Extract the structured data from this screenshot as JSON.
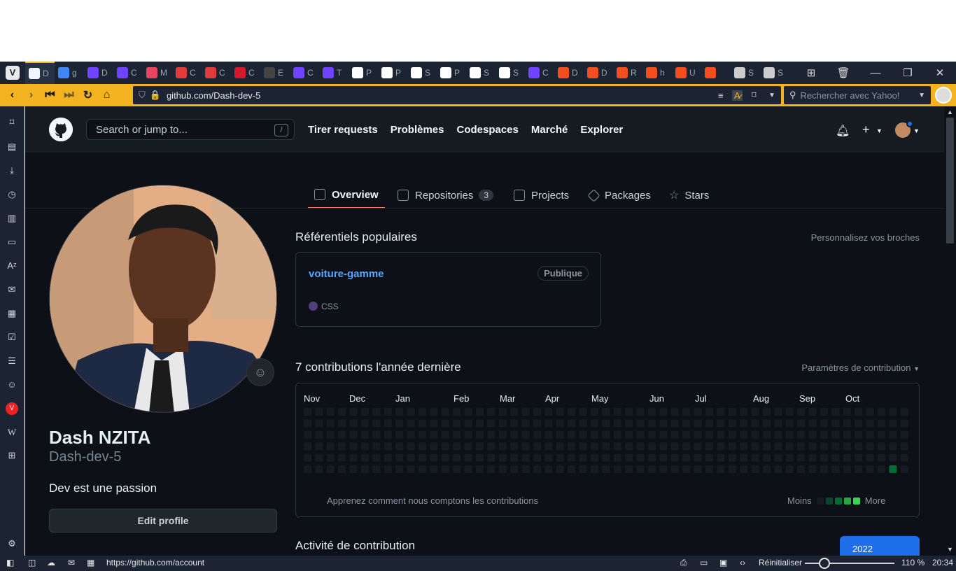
{
  "tabs": [
    {
      "label": "D",
      "icon": "github-icon",
      "color": "#f0f6fc",
      "active": true
    },
    {
      "label": "g",
      "icon": "google-icon",
      "color": "#4285f4"
    },
    {
      "label": "D",
      "icon": "tab-icon",
      "color": "#6e44ff"
    },
    {
      "label": "C",
      "icon": "tab-icon",
      "color": "#6e44ff"
    },
    {
      "label": "M",
      "icon": "tab-icon",
      "color": "#e94560"
    },
    {
      "label": "C",
      "icon": "tab-icon",
      "color": "#e23b3b"
    },
    {
      "label": "C",
      "icon": "tab-icon",
      "color": "#e23b3b"
    },
    {
      "label": "C",
      "icon": "opera-icon",
      "color": "#d11a2a"
    },
    {
      "label": "E",
      "icon": "tab-icon",
      "color": "#444444"
    },
    {
      "label": "C",
      "icon": "tab-icon",
      "color": "#6e44ff"
    },
    {
      "label": "T",
      "icon": "tab-icon",
      "color": "#6e44ff"
    },
    {
      "label": "P",
      "icon": "codepen-icon",
      "color": "#ffffff"
    },
    {
      "label": "P",
      "icon": "codepen-icon",
      "color": "#ffffff"
    },
    {
      "label": "S",
      "icon": "codepen-icon",
      "color": "#ffffff"
    },
    {
      "label": "P",
      "icon": "codepen-icon",
      "color": "#ffffff"
    },
    {
      "label": "S",
      "icon": "codepen-icon",
      "color": "#ffffff"
    },
    {
      "label": "S",
      "icon": "codepen-icon",
      "color": "#ffffff"
    },
    {
      "label": "C",
      "icon": "tab-icon",
      "color": "#6e44ff"
    },
    {
      "label": "D",
      "icon": "figma-icon",
      "color": "#f24e1e"
    },
    {
      "label": "D",
      "icon": "figma-icon",
      "color": "#f24e1e"
    },
    {
      "label": "R",
      "icon": "figma-icon",
      "color": "#f24e1e"
    },
    {
      "label": "h",
      "icon": "figma-icon",
      "color": "#f24e1e"
    },
    {
      "label": "U",
      "icon": "figma-icon",
      "color": "#f24e1e"
    },
    {
      "label": "",
      "icon": "figma-icon",
      "color": "#f24e1e"
    },
    {
      "label": "S",
      "icon": "apps-icon",
      "color": "#cccccc"
    },
    {
      "label": "S",
      "icon": "apps-icon",
      "color": "#cccccc"
    }
  ],
  "browser": {
    "url": "github.com/Dash-dev-5",
    "search_placeholder": "Rechercher avec Yahoo!"
  },
  "github": {
    "search_placeholder": "Search or jump to...",
    "slash": "/",
    "nav": [
      "Tirer requests",
      "Problèmes",
      "Codespaces",
      "Marché",
      "Explorer"
    ]
  },
  "profile_tabs": {
    "overview": "Overview",
    "repositories": "Repositories",
    "repositories_count": "3",
    "projects": "Projects",
    "packages": "Packages",
    "stars": "Stars"
  },
  "user": {
    "name": "Dash NZITA",
    "login": "Dash-dev-5",
    "bio": "Dev est une passion",
    "edit_button": "Edit profile"
  },
  "pinned": {
    "title": "Référentiels populaires",
    "customize": "Personnalisez vos broches",
    "repo": {
      "name": "voiture-gamme",
      "visibility": "Publique",
      "language": "CSS",
      "language_color": "#563d7c"
    }
  },
  "contributions": {
    "title": "7 contributions l'année dernière",
    "settings": "Paramètres de contribution",
    "months": [
      "Nov",
      "Dec",
      "Jan",
      "Feb",
      "Mar",
      "Apr",
      "May",
      "Jun",
      "Jul",
      "Aug",
      "Sep",
      "Oct"
    ],
    "learn": "Apprenez comment nous comptons les contributions",
    "less": "Moins",
    "more": "More",
    "activity_title": "Activité de contribution",
    "year": "2022",
    "colors": {
      "empty": "#161b22",
      "l1": "#0e4429",
      "l2": "#006d32",
      "l3": "#26a641",
      "l4": "#39d353"
    }
  },
  "status": {
    "link": "https://github.com/account",
    "reset": "Réinitialiser",
    "zoom": "110 %",
    "time": "20:34"
  }
}
